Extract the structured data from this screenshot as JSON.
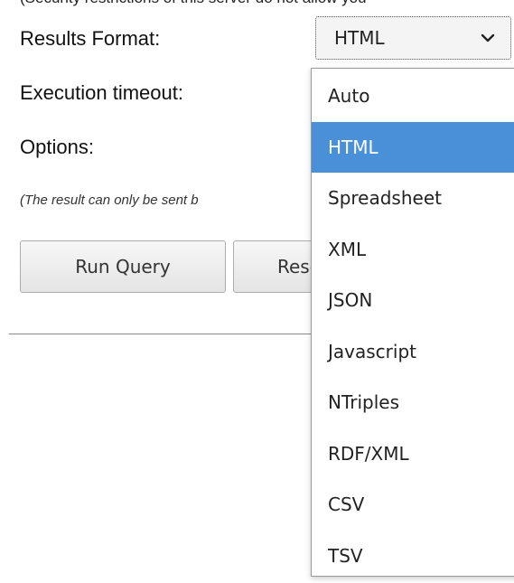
{
  "form": {
    "clipped_note": "(Security restrictions of this server do not allow you",
    "results_format_label": "Results Format:",
    "execution_timeout_label": "Execution timeout:",
    "options_label": "Options:",
    "result_note": "(The result can only be sent b"
  },
  "buttons": {
    "run_query": "Run Query",
    "reset": "Reset"
  },
  "results_format": {
    "selected": "HTML",
    "options": [
      "Auto",
      "HTML",
      "Spreadsheet",
      "XML",
      "JSON",
      "Javascript",
      "NTriples",
      "RDF/XML",
      "CSV",
      "TSV"
    ],
    "highlight_color": "#4a90d9"
  },
  "icons": {
    "select_toggle": "chevron-down-icon"
  }
}
